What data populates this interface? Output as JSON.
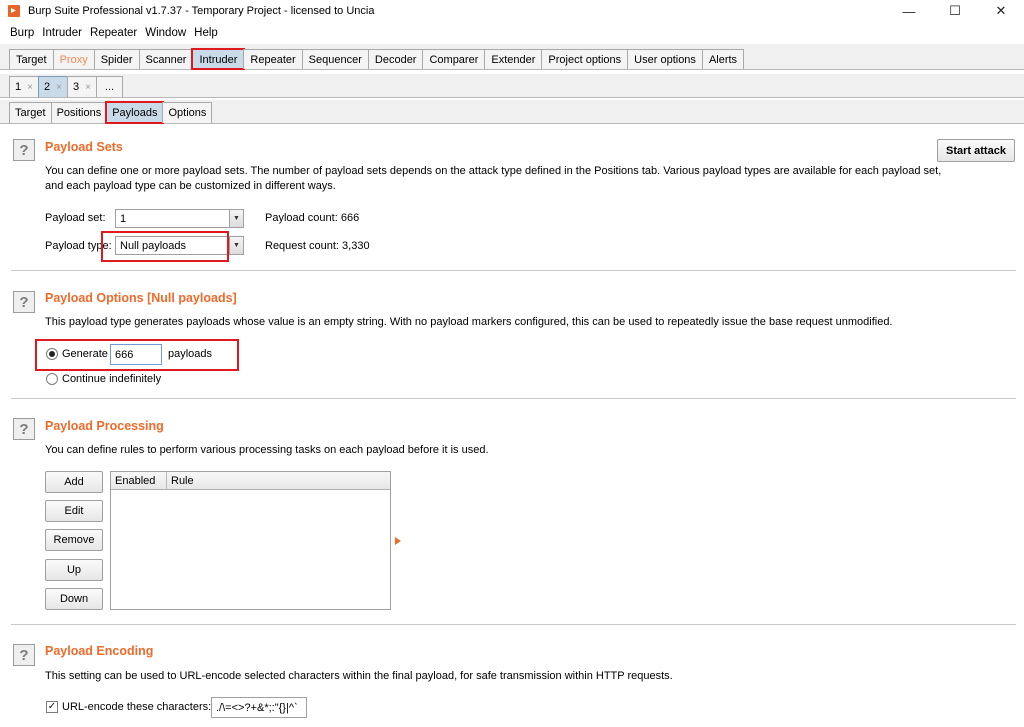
{
  "window": {
    "title": "Burp Suite Professional v1.7.37 - Temporary Project - licensed to Uncia",
    "minimize": "—",
    "maximize": "☐",
    "close": "✕"
  },
  "menu": [
    "Burp",
    "Intruder",
    "Repeater",
    "Window",
    "Help"
  ],
  "main_tabs": [
    "Target",
    "Proxy",
    "Spider",
    "Scanner",
    "Intruder",
    "Repeater",
    "Sequencer",
    "Decoder",
    "Comparer",
    "Extender",
    "Project options",
    "User options",
    "Alerts"
  ],
  "attack_tabs": [
    {
      "label": "1",
      "close": "×"
    },
    {
      "label": "2",
      "close": "×"
    },
    {
      "label": "3",
      "close": "×"
    },
    {
      "label": "...",
      "close": ""
    }
  ],
  "sub_tabs": [
    "Target",
    "Positions",
    "Payloads",
    "Options"
  ],
  "payload_sets": {
    "title": "Payload Sets",
    "description": "You can define one or more payload sets. The number of payload sets depends on the attack type defined in the Positions tab. Various payload types are available for each payload set, and each payload type can be customized in different ways.",
    "start_attack": "Start attack",
    "payload_set_label": "Payload set:",
    "payload_set_value": "1",
    "payload_type_label": "Payload type:",
    "payload_type_value": "Null payloads",
    "payload_count": "Payload count:  666",
    "request_count": "Request count:  3,330"
  },
  "payload_options": {
    "title": "Payload Options [Null payloads]",
    "description": "This payload type generates payloads whose value is an empty string. With no payload markers configured, this can be used to repeatedly issue the base request unmodified.",
    "generate_label": "Generate",
    "generate_value": "666",
    "payloads_suffix": "payloads",
    "continue_label": "Continue indefinitely"
  },
  "payload_processing": {
    "title": "Payload Processing",
    "description": "You can define rules to perform various processing tasks on each payload before it is used.",
    "buttons": [
      "Add",
      "Edit",
      "Remove",
      "Up",
      "Down"
    ],
    "columns": [
      "Enabled",
      "Rule"
    ]
  },
  "payload_encoding": {
    "title": "Payload Encoding",
    "description": "This setting can be used to URL-encode selected characters within the final payload, for safe transmission within HTTP requests.",
    "checkbox_label": "URL-encode these characters:",
    "checkbox_mark": "✓",
    "characters": "./\\=<>?+&*;:\"{}|^`"
  },
  "help_glyph": "?"
}
